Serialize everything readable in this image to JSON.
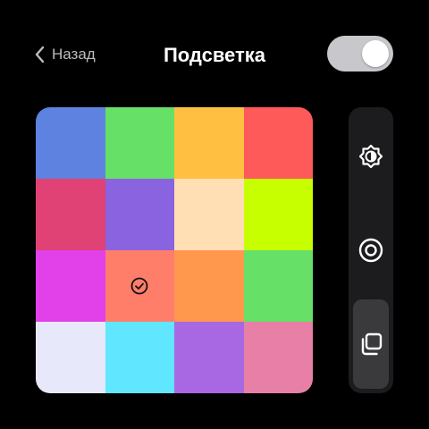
{
  "header": {
    "back_label": "Назад",
    "title": "Подсветка"
  },
  "toggle": {
    "state": "on",
    "track_color": "#c7c7cc",
    "knob_color": "#ffffff"
  },
  "palette": {
    "selected_index": 9,
    "colors": [
      "#5e82df",
      "#66e066",
      "#ffc042",
      "#ff5a5a",
      "#e04275",
      "#8a63e0",
      "#ffdfb3",
      "#c8ff00",
      "#e240e8",
      "#ff7e6a",
      "#ff984d",
      "#66e066",
      "#e8e8fb",
      "#60e6fe",
      "#a868e4",
      "#e87fa6"
    ]
  },
  "sidebar": {
    "items": [
      {
        "icon": "brightness-icon",
        "active": false
      },
      {
        "icon": "record-icon",
        "active": false
      },
      {
        "icon": "copy-icon",
        "active": true
      }
    ]
  }
}
